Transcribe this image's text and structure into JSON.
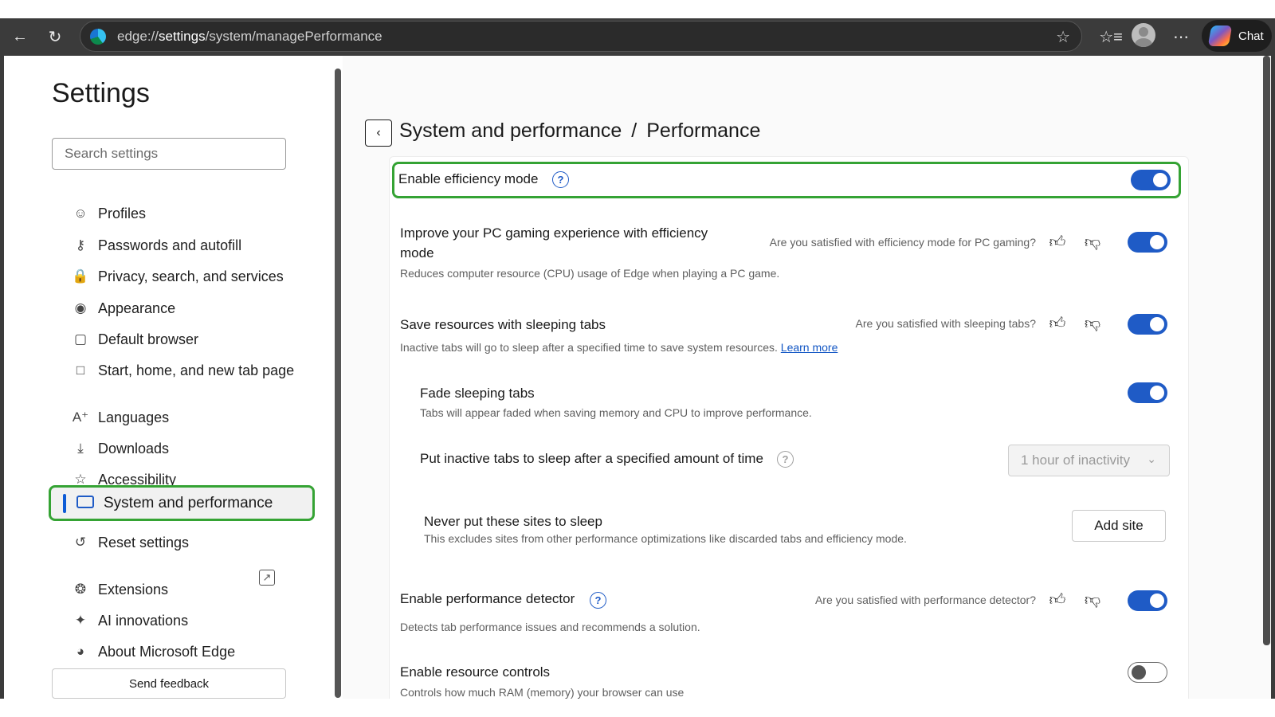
{
  "browser": {
    "url_prefix": "edge://",
    "url_host": "settings",
    "url_path": "/system/managePerformance",
    "chat_label": "Chat",
    "icons": {
      "back": "back-arrow-icon",
      "refresh": "refresh-icon",
      "favorite": "star-icon",
      "favorites": "favorites-icon",
      "profile": "profile-avatar",
      "more": "more-icon",
      "copilot": "copilot-icon"
    }
  },
  "sidebar": {
    "title": "Settings",
    "search_placeholder": "Search settings",
    "items": [
      {
        "label": "Profiles",
        "icon": "profile-icon"
      },
      {
        "label": "Passwords and autofill",
        "icon": "key-icon"
      },
      {
        "label": "Privacy, search, and services",
        "icon": "lock-icon"
      },
      {
        "label": "Appearance",
        "icon": "palette-icon"
      },
      {
        "label": "Default browser",
        "icon": "browser-icon"
      },
      {
        "label": "Start, home, and new tab page",
        "icon": "home-icon"
      },
      {
        "label": "Languages",
        "icon": "languages-icon"
      },
      {
        "label": "Downloads",
        "icon": "download-icon"
      },
      {
        "label": "Accessibility",
        "icon": "accessibility-icon"
      },
      {
        "label": "System and performance",
        "icon": "laptop-icon",
        "active": true
      },
      {
        "label": "Reset settings",
        "icon": "reset-icon"
      },
      {
        "label": "Extensions",
        "icon": "puzzle-icon"
      },
      {
        "label": "AI innovations",
        "icon": "ai-icon"
      },
      {
        "label": "About Microsoft Edge",
        "icon": "edge-icon"
      }
    ],
    "feedback_label": "Send feedback"
  },
  "main": {
    "breadcrumb": {
      "parent": "System and performance",
      "separator": "/",
      "current": "Performance"
    },
    "rows": {
      "efficiency": {
        "title": "Enable efficiency mode",
        "on": true
      },
      "gaming": {
        "title": "Improve your PC gaming experience with efficiency mode",
        "desc": "Reduces computer resource (CPU) usage of Edge when playing a PC game.",
        "question": "Are you satisfied with efficiency mode for PC gaming?",
        "on": true
      },
      "sleeping": {
        "title": "Save resources with sleeping tabs",
        "desc": "Inactive tabs will go to sleep after a specified time to save system resources.",
        "link": "Learn more",
        "question": "Are you satisfied with sleeping tabs?",
        "on": true
      },
      "fade": {
        "title": "Fade sleeping tabs",
        "desc": "Tabs will appear faded when saving memory and CPU to improve performance.",
        "on": true
      },
      "sleep_after": {
        "title": "Put inactive tabs to sleep after a specified amount of time",
        "selected": "1 hour of inactivity"
      },
      "never_sleep": {
        "title": "Never put these sites to sleep",
        "desc": "This excludes sites from other performance optimizations like discarded tabs and efficiency mode.",
        "button": "Add site"
      },
      "detector": {
        "title": "Enable performance detector",
        "desc": "Detects tab performance issues and recommends a solution.",
        "question": "Are you satisfied with performance detector?",
        "on": true
      },
      "resource": {
        "title": "Enable resource controls",
        "desc": "Controls how much RAM (memory) your browser can use",
        "on": false
      }
    },
    "colors": {
      "accent": "#1f5bc6",
      "highlight": "#35a334"
    }
  }
}
